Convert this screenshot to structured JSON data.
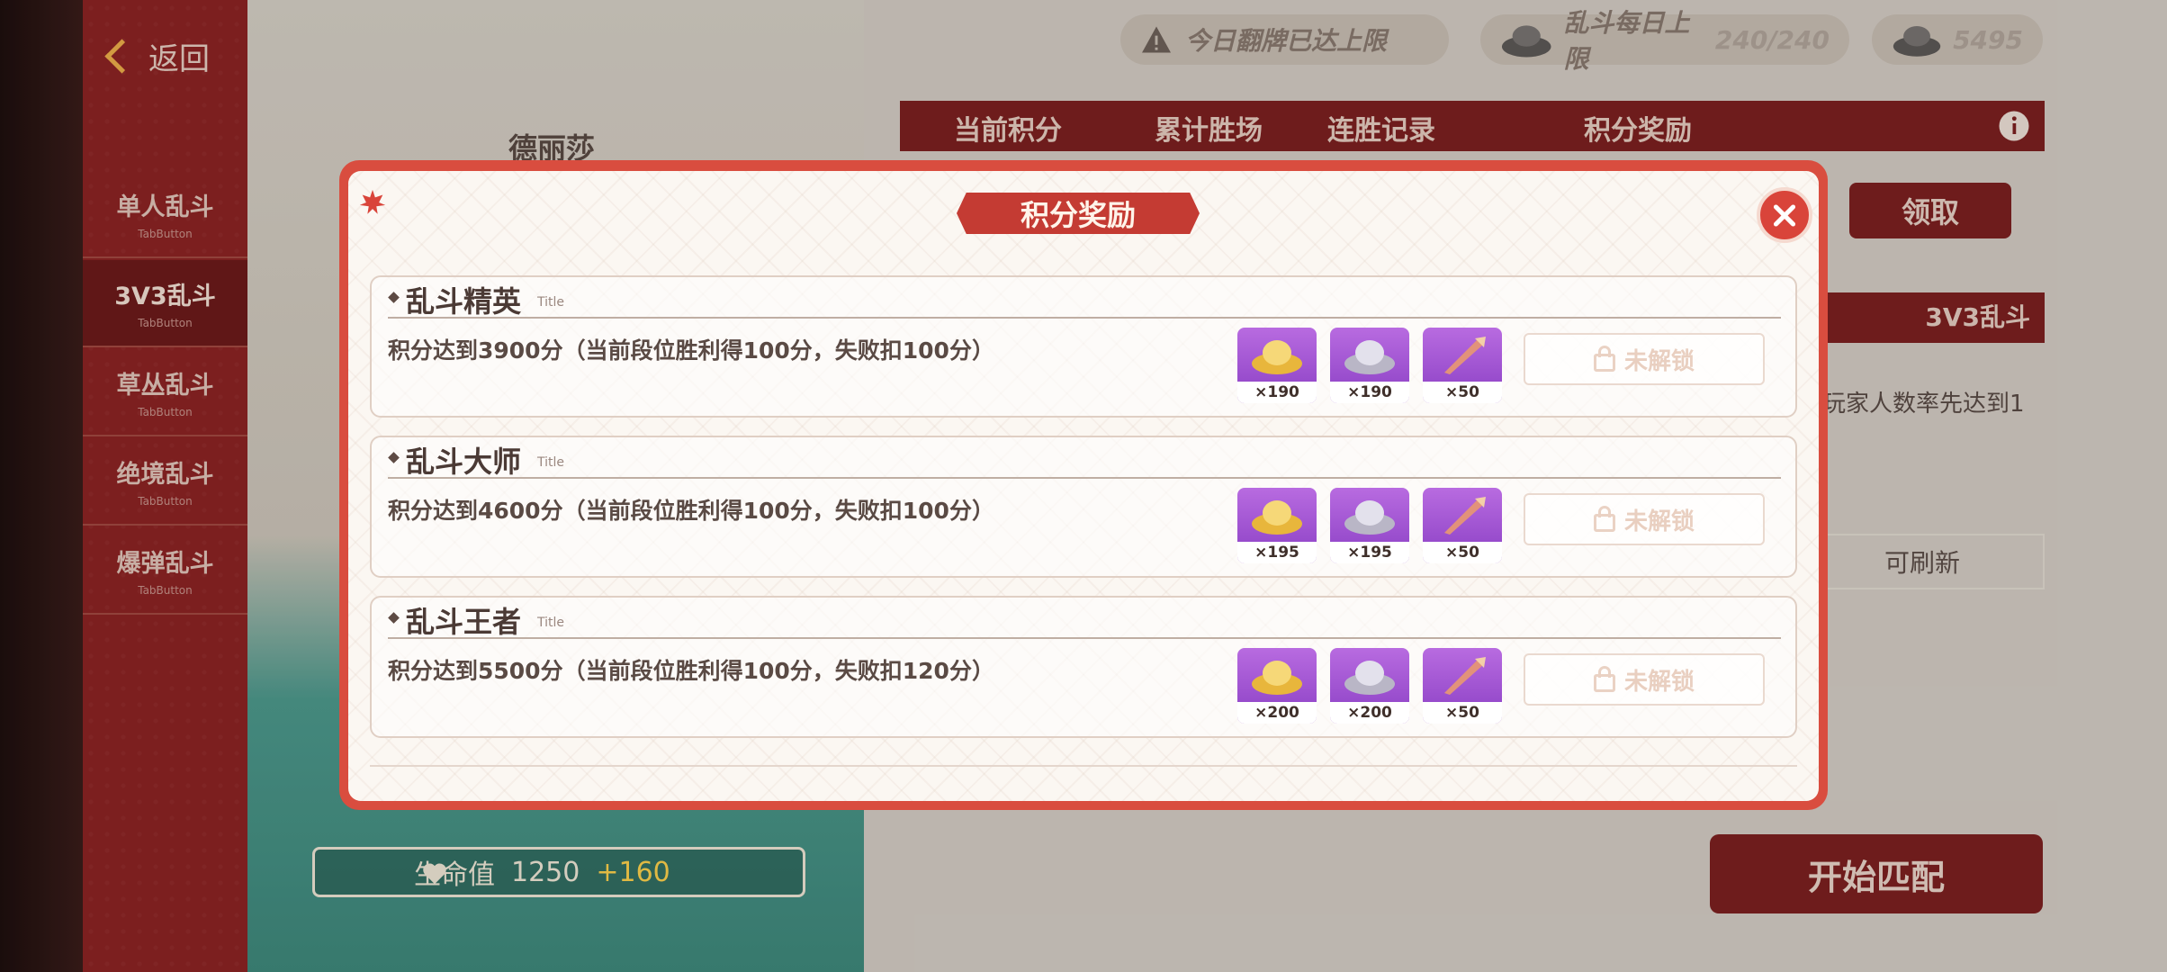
{
  "sidebar": {
    "back_label": "返回",
    "tabs": [
      {
        "label": "单人乱斗",
        "sub": "TabButton"
      },
      {
        "label": "3V3乱斗",
        "sub": "TabButton"
      },
      {
        "label": "草丛乱斗",
        "sub": "TabButton"
      },
      {
        "label": "绝境乱斗",
        "sub": "TabButton"
      },
      {
        "label": "爆弹乱斗",
        "sub": "TabButton"
      }
    ]
  },
  "scene": {
    "hero_name": "德丽莎",
    "hp_label": "生命值",
    "hp_value": "1250",
    "hp_bonus": "+160"
  },
  "topbar": {
    "flip_limit": "今日翻牌已达上限",
    "daily_limit_label": "乱斗每日上限",
    "daily_limit_value": "240/240",
    "currency_value": "5495"
  },
  "stats_tabs": [
    "当前积分",
    "累计胜场",
    "连胜记录",
    "积分奖励"
  ],
  "right_panel": {
    "claim_label": "领取",
    "mode_label": "3V3乱斗",
    "rule_snippet": "玩家人数率先达到1",
    "refresh_label": "可刷新",
    "start_label": "开始匹配"
  },
  "modal": {
    "title": "积分奖励",
    "rewards": [
      {
        "title": "乱斗精英",
        "title_sub": "Title",
        "desc": "积分达到3900分（当前段位胜利得100分，失败扣100分）",
        "items": [
          {
            "icon": "gold-ingot-icon",
            "qty": "×190"
          },
          {
            "icon": "silver-ingot-icon",
            "qty": "×190"
          },
          {
            "icon": "feather-token-icon",
            "qty": "×50"
          }
        ],
        "status": "未解锁"
      },
      {
        "title": "乱斗大师",
        "title_sub": "Title",
        "desc": "积分达到4600分（当前段位胜利得100分，失败扣100分）",
        "items": [
          {
            "icon": "gold-ingot-icon",
            "qty": "×195"
          },
          {
            "icon": "silver-ingot-icon",
            "qty": "×195"
          },
          {
            "icon": "feather-token-icon",
            "qty": "×50"
          }
        ],
        "status": "未解锁"
      },
      {
        "title": "乱斗王者",
        "title_sub": "Title",
        "desc": "积分达到5500分（当前段位胜利得100分，失败扣120分）",
        "items": [
          {
            "icon": "gold-ingot-icon",
            "qty": "×200"
          },
          {
            "icon": "silver-ingot-icon",
            "qty": "×200"
          },
          {
            "icon": "feather-token-icon",
            "qty": "×50"
          }
        ],
        "status": "未解锁"
      }
    ]
  }
}
